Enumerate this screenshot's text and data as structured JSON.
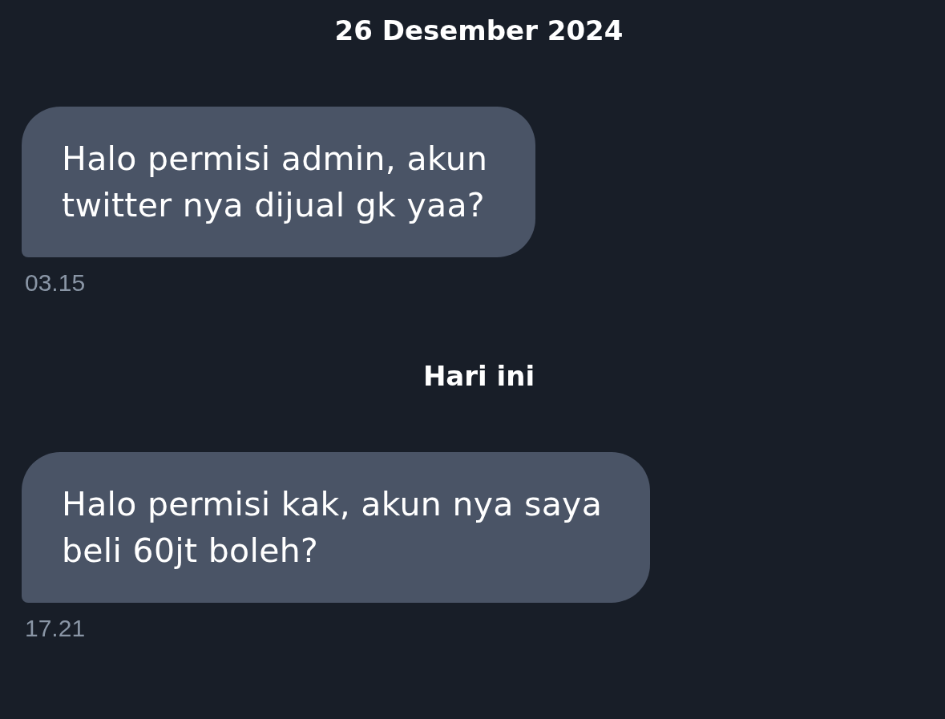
{
  "conversation": [
    {
      "kind": "date_separator",
      "label": "26 Desember 2024"
    },
    {
      "kind": "message",
      "text": "Halo permisi admin, akun\ntwitter nya dijual gk yaa?",
      "time": "03.15"
    },
    {
      "kind": "date_separator",
      "label": "Hari ini"
    },
    {
      "kind": "message",
      "text": "Halo permisi kak, akun nya saya\nbeli 60jt boleh?",
      "time": "17.21"
    }
  ]
}
